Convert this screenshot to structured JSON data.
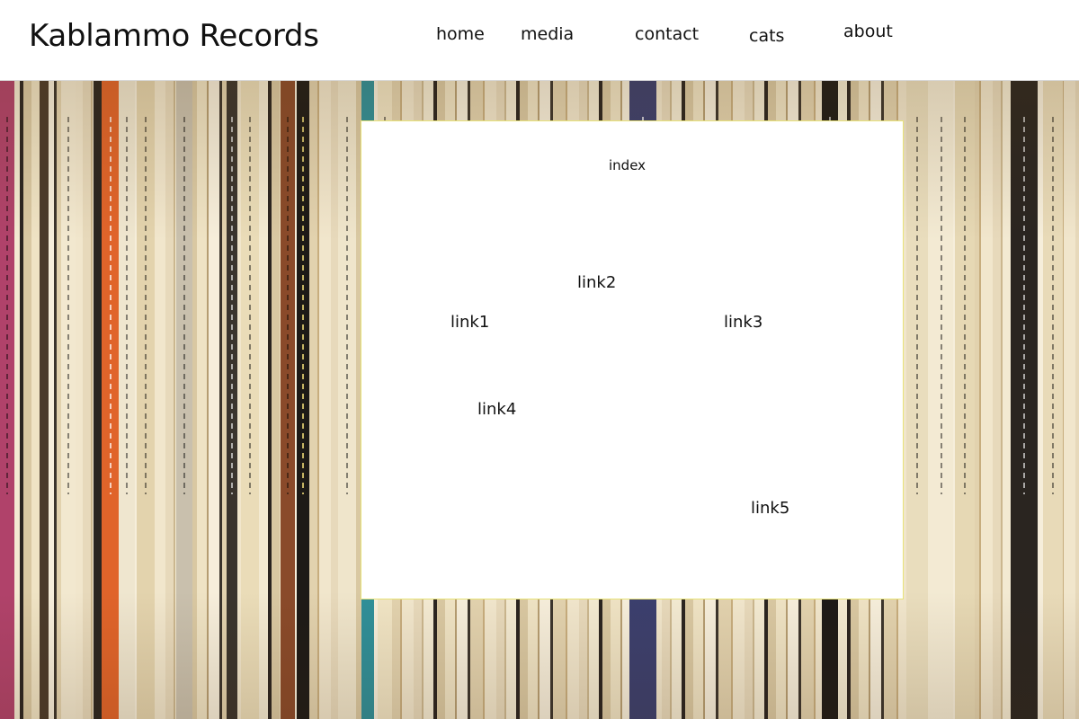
{
  "header": {
    "site_title": "Kablammo Records",
    "nav": [
      {
        "label": "home"
      },
      {
        "label": "media"
      },
      {
        "label": "contact"
      },
      {
        "label": "cats"
      },
      {
        "label": "about"
      }
    ]
  },
  "panel": {
    "index_label": "index",
    "links": [
      "link1",
      "link2",
      "link3",
      "link4",
      "link5"
    ]
  },
  "colors": {
    "spine_orange": "#e0642a",
    "spine_black": "#1d1a17",
    "spine_teal": "#2f8f99",
    "spine_magenta": "#b0426a",
    "spine_navy": "#3b3f6e",
    "panel_border": "#e8e37a"
  }
}
